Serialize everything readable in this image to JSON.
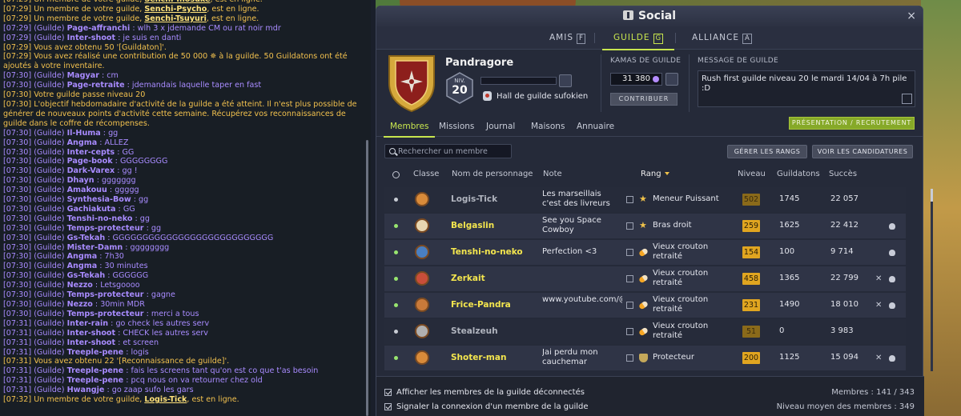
{
  "chat": {
    "lines": [
      {
        "t": "[07:29]",
        "kind": "sys",
        "pre": " Un membre de votre guilde, ",
        "name": "Senchi-Inosuke",
        "post": ", est en ligne."
      },
      {
        "t": "[07:29]",
        "kind": "sys",
        "pre": " Un membre de votre guilde, ",
        "name": "Senchi-Psycho",
        "post": ", est en ligne."
      },
      {
        "t": "[07:29]",
        "kind": "sys",
        "pre": " Un membre de votre guilde, ",
        "name": "Senchi-Tsuyuri",
        "post": ", est en ligne."
      },
      {
        "t": "[07:29]",
        "kind": "guild",
        "user": "Page-affranchi",
        "msg": " : wlh 3 x jdemande CM ou rat noir mdr"
      },
      {
        "t": "[07:29]",
        "kind": "guild",
        "user": "Inter-shoot",
        "msg": " : je suis en danti"
      },
      {
        "t": "[07:29]",
        "kind": "sysplain",
        "text": " Vous avez obtenu 50 '[Guildaton]'."
      },
      {
        "t": "[07:29]",
        "kind": "sysplain",
        "text": " Vous avez réalisé une contribution de 50 000 ✵ à la guilde. 50 Guildatons ont été ajoutés à votre inventaire."
      },
      {
        "t": "[07:30]",
        "kind": "guild",
        "user": "Magyar",
        "msg": " : cm"
      },
      {
        "t": "[07:30]",
        "kind": "guild",
        "user": "Page-retraite",
        "msg": " : jdemandais laquelle taper en fast"
      },
      {
        "t": "[07:30]",
        "kind": "sysplain",
        "text": " Votre guilde passe niveau 20"
      },
      {
        "t": "[07:30]",
        "kind": "sysplain",
        "text": " L'objectif hebdomadaire d'activité de la guilde a été atteint. Il n'est plus possible de générer de nouveaux points d'activité cette semaine. Récupérez vos reconnaissances de guilde dans le coffre de récompenses."
      },
      {
        "t": "[07:30]",
        "kind": "guild",
        "user": "Il-Huma",
        "msg": " : gg"
      },
      {
        "t": "[07:30]",
        "kind": "guild",
        "user": "Angma",
        "msg": " : ALLEZ"
      },
      {
        "t": "[07:30]",
        "kind": "guild",
        "user": "Inter-cepts",
        "msg": " : GG"
      },
      {
        "t": "[07:30]",
        "kind": "guild",
        "user": "Page-book",
        "msg": " : GGGGGGGG"
      },
      {
        "t": "[07:30]",
        "kind": "guild",
        "user": "Dark-Varex",
        "msg": " : gg !"
      },
      {
        "t": "[07:30]",
        "kind": "guild",
        "user": "Dhayn",
        "msg": " : ggggggg"
      },
      {
        "t": "[07:30]",
        "kind": "guild",
        "user": "Amakouu",
        "msg": " : ggggg"
      },
      {
        "t": "[07:30]",
        "kind": "guild",
        "user": "Synthesia-Bow",
        "msg": " : gg"
      },
      {
        "t": "[07:30]",
        "kind": "guild",
        "user": "Gachiakuta",
        "msg": " : GG"
      },
      {
        "t": "[07:30]",
        "kind": "guild",
        "user": "Tenshi-no-neko",
        "msg": " : gg"
      },
      {
        "t": "[07:30]",
        "kind": "guild",
        "user": "Temps-protecteur",
        "msg": " : gg"
      },
      {
        "t": "[07:30]",
        "kind": "guild",
        "user": "Gs-Tekah",
        "msg": " : GGGGGGGGGGGGGGGGGGGGGGGGGGG"
      },
      {
        "t": "[07:30]",
        "kind": "guild",
        "user": "Mister-Damn",
        "msg": " : gggggggg"
      },
      {
        "t": "[07:30]",
        "kind": "guild",
        "user": "Angma",
        "msg": " : 7h30"
      },
      {
        "t": "[07:30]",
        "kind": "guild",
        "user": "Angma",
        "msg": " : 30 minutes"
      },
      {
        "t": "[07:30]",
        "kind": "guild",
        "user": "Gs-Tekah",
        "msg": " : GGGGGG"
      },
      {
        "t": "[07:30]",
        "kind": "guild",
        "user": "Nezzo",
        "msg": " : Letsgoooo"
      },
      {
        "t": "[07:30]",
        "kind": "guild",
        "user": "Temps-protecteur",
        "msg": " : gagne"
      },
      {
        "t": "[07:30]",
        "kind": "guild",
        "user": "Nezzo",
        "msg": " : 30min MDR"
      },
      {
        "t": "[07:30]",
        "kind": "guild",
        "user": "Temps-protecteur",
        "msg": " : merci a tous"
      },
      {
        "t": "[07:31]",
        "kind": "guild",
        "user": "Inter-rain",
        "msg": " : go check les autres serv"
      },
      {
        "t": "[07:31]",
        "kind": "guild",
        "user": "Inter-shoot",
        "msg": " : CHECK les autres serv"
      },
      {
        "t": "[07:31]",
        "kind": "guild",
        "user": "Inter-shoot",
        "msg": " : et screen"
      },
      {
        "t": "[07:31]",
        "kind": "guild",
        "user": "Treeple-pene",
        "msg": " : logis"
      },
      {
        "t": "[07:31]",
        "kind": "sysplain",
        "text": " Vous avez obtenu 22 '[Reconnaissance de guilde]'."
      },
      {
        "t": "[07:31]",
        "kind": "guild",
        "user": "Treeple-pene",
        "msg": " : fais les screens tant qu'on est co que t'as besoin"
      },
      {
        "t": "[07:31]",
        "kind": "guild",
        "user": "Treeple-pene",
        "msg": " : pcq nous on va retourner chez old"
      },
      {
        "t": "[07:31]",
        "kind": "guild",
        "user": "Hwangje",
        "msg": " : go zaap sufo les gars"
      },
      {
        "t": "[07:32]",
        "kind": "sys",
        "pre": " Un membre de votre guilde, ",
        "name": "Logis-Tick",
        "post": ", est en ligne."
      }
    ],
    "guild_tag": " (Guilde) "
  },
  "window": {
    "title": "Social",
    "close": "×",
    "tabs": [
      {
        "label": "AMIS",
        "key": "F"
      },
      {
        "label": "GUILDE",
        "key": "G"
      },
      {
        "label": "ALLIANCE",
        "key": "A"
      }
    ]
  },
  "guild": {
    "name": "Pandragore",
    "level_label": "NIV.",
    "level": "20",
    "xp_fraction": 0.0,
    "hall": "Hall de guilde sufokien",
    "kamas_label": "KAMAS DE GUILDE",
    "kamas": "31 380",
    "contribute": "CONTRIBUER",
    "message_label": "MESSAGE DE GUILDE",
    "message": "Rush first guilde niveau 20 le mardi 14/04 à 7h pile :D"
  },
  "subtabs": [
    "Membres",
    "Missions",
    "Journal",
    "Maisons",
    "Annuaire"
  ],
  "recruit_button": "PRÉSENTATION / RECRUTEMENT",
  "toolbar": {
    "search_placeholder": "Rechercher un membre",
    "ranks_button": "GÉRER LES RANGS",
    "applications_button": "VOIR LES CANDIDATURES"
  },
  "table": {
    "headers": {
      "class": "Classe",
      "name": "Nom de personnage",
      "note": "Note",
      "rank": "Rang",
      "level": "Niveau",
      "guildatons": "Guildatons",
      "success": "Succès"
    },
    "rows": [
      {
        "online": false,
        "name": "Logis-Tick",
        "note": "Les marseillais c'est des livreurs",
        "rank": "Meneur Puissant",
        "rank_icon": "star",
        "level": "502",
        "guildatons": "1745",
        "success": "22 057",
        "tools": false,
        "bag": false
      },
      {
        "online": true,
        "name": "Belgaslin",
        "note": "See you Space Cowboy",
        "rank": "Bras droit",
        "rank_icon": "star",
        "level": "259",
        "guildatons": "1625",
        "success": "22 412",
        "tools": false,
        "bag": true
      },
      {
        "online": true,
        "name": "Tenshi-no-neko",
        "note": "Perfection <3",
        "rank": "Vieux crouton retraité",
        "rank_icon": "pill",
        "level": "154",
        "guildatons": "100",
        "success": "9 714",
        "tools": false,
        "bag": true
      },
      {
        "online": true,
        "name": "Zerkait",
        "note": "",
        "rank": "Vieux crouton retraité",
        "rank_icon": "pill",
        "level": "458",
        "guildatons": "1365",
        "success": "22 799",
        "tools": true,
        "bag": true
      },
      {
        "online": true,
        "name": "Frice-Pandra",
        "note": "www.youtube.com/@FricexPandra",
        "rank": "Vieux crouton retraité",
        "rank_icon": "pill",
        "level": "231",
        "guildatons": "1490",
        "success": "18 010",
        "tools": true,
        "bag": true
      },
      {
        "online": false,
        "name": "Stealzeuh",
        "note": "",
        "rank": "Vieux crouton retraité",
        "rank_icon": "pill",
        "level": "51",
        "guildatons": "0",
        "success": "3 983",
        "tools": false,
        "bag": false
      },
      {
        "online": true,
        "name": "Shoter-man",
        "note": "Jai perdu mon cauchemar",
        "rank": "Protecteur",
        "rank_icon": "shield",
        "level": "200",
        "guildatons": "1125",
        "success": "15 094",
        "tools": true,
        "bag": true
      }
    ]
  },
  "footer": {
    "show_offline": "Afficher les membres de la guilde déconnectés",
    "notify_login": "Signaler la connexion d'un membre de la guilde",
    "members": "Membres : 141 / 343",
    "avg_level": "Niveau moyen des membres : 349"
  },
  "colors": {
    "accent": "#c8e64e",
    "guild_chat": "#a88bff",
    "system_chat": "#f2c14e",
    "level_badge": "#e0a520"
  }
}
